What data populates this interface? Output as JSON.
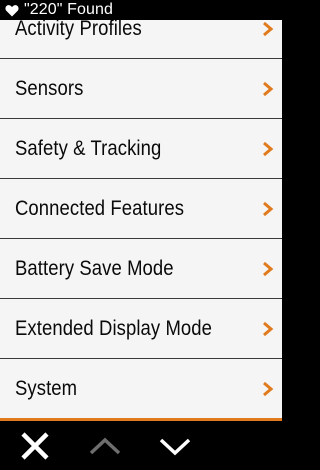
{
  "notification": {
    "icon": "heart-icon",
    "text": "\"220\" Found"
  },
  "menu": {
    "items": [
      {
        "label": "Activity Profiles",
        "icon": "chevron-right-icon"
      },
      {
        "label": "Sensors",
        "icon": "chevron-right-icon"
      },
      {
        "label": "Safety & Tracking",
        "icon": "chevron-right-icon"
      },
      {
        "label": "Connected Features",
        "icon": "chevron-right-icon"
      },
      {
        "label": "Battery Save Mode",
        "icon": "chevron-right-icon"
      },
      {
        "label": "Extended Display Mode",
        "icon": "chevron-right-icon"
      },
      {
        "label": "System",
        "icon": "chevron-right-icon"
      }
    ]
  },
  "bottom_bar": {
    "close_icon": "close-icon",
    "up_icon": "chevron-up-icon",
    "down_icon": "chevron-down-icon",
    "up_enabled": false
  },
  "colors": {
    "accent": "#e07a1c",
    "background": "#f5f5f5",
    "divider": "#3a3a3a",
    "bar": "#000000",
    "disabled_icon": "#6e6e6e",
    "enabled_icon": "#ffffff"
  }
}
